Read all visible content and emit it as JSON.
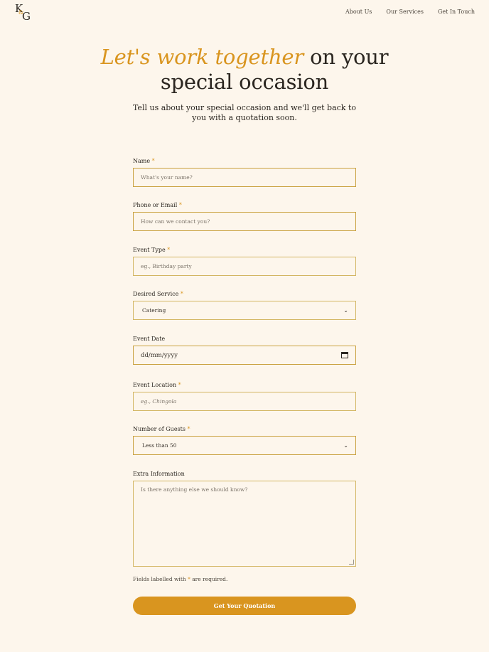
{
  "brand": {
    "letter1": "K",
    "ampersand": "&",
    "letter2": "G"
  },
  "nav": {
    "items": [
      "About Us",
      "Our Services",
      "Get In Touch"
    ]
  },
  "hero": {
    "title_accent": "Let's work together",
    "title_rest": "on your",
    "title_line2": "special occasion",
    "subtitle": "Tell us about your special occasion and we'll get back to you with a quotation soon."
  },
  "form": {
    "required_mark": "*",
    "name": {
      "label": "Name",
      "placeholder": "What's your name?"
    },
    "contact": {
      "label": "Phone or Email",
      "placeholder": "How can we contact you?"
    },
    "event_type": {
      "label": "Event Type",
      "placeholder": "eg., Birthday party"
    },
    "service": {
      "label": "Desired Service",
      "value": "Catering"
    },
    "date": {
      "label": "Event Date",
      "value": "dd/mm/yyyy"
    },
    "location": {
      "label": "Event Location",
      "placeholder": "eg., Chingola"
    },
    "guests": {
      "label": "Number of Guests",
      "value": "Less than 50"
    },
    "extra": {
      "label": "Extra Information",
      "placeholder": "Is there anything else we should know?"
    },
    "note_pre": "Fields labelled with",
    "note_post": "are required.",
    "submit_label": "Get Your Quotation"
  },
  "icons": {
    "select": "chevron-down-icon",
    "date": "calendar-icon"
  },
  "colors": {
    "accent": "#d9951f",
    "background": "#fdf6ec",
    "border": "#d3b663"
  }
}
